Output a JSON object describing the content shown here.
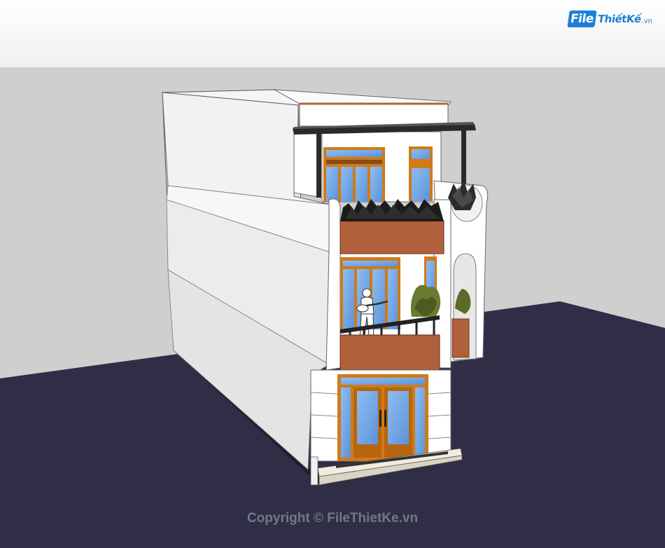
{
  "watermark": {
    "logo_file": "File",
    "logo_rest": "ThiếtKế",
    "logo_tld": ".vn",
    "copyright": "Copyright © FileThietKe.vn"
  },
  "colors": {
    "sky_top": "#f5f5f5",
    "backdrop": "#cfcfcf",
    "ground": "#302e46",
    "wall": "#ffffff",
    "side_wall": "#ececec",
    "wood": "#b0613c",
    "glass": "#6ea6e6",
    "frame": "#d07a18",
    "railing": "#222222",
    "brand": "#1e7fd6"
  }
}
